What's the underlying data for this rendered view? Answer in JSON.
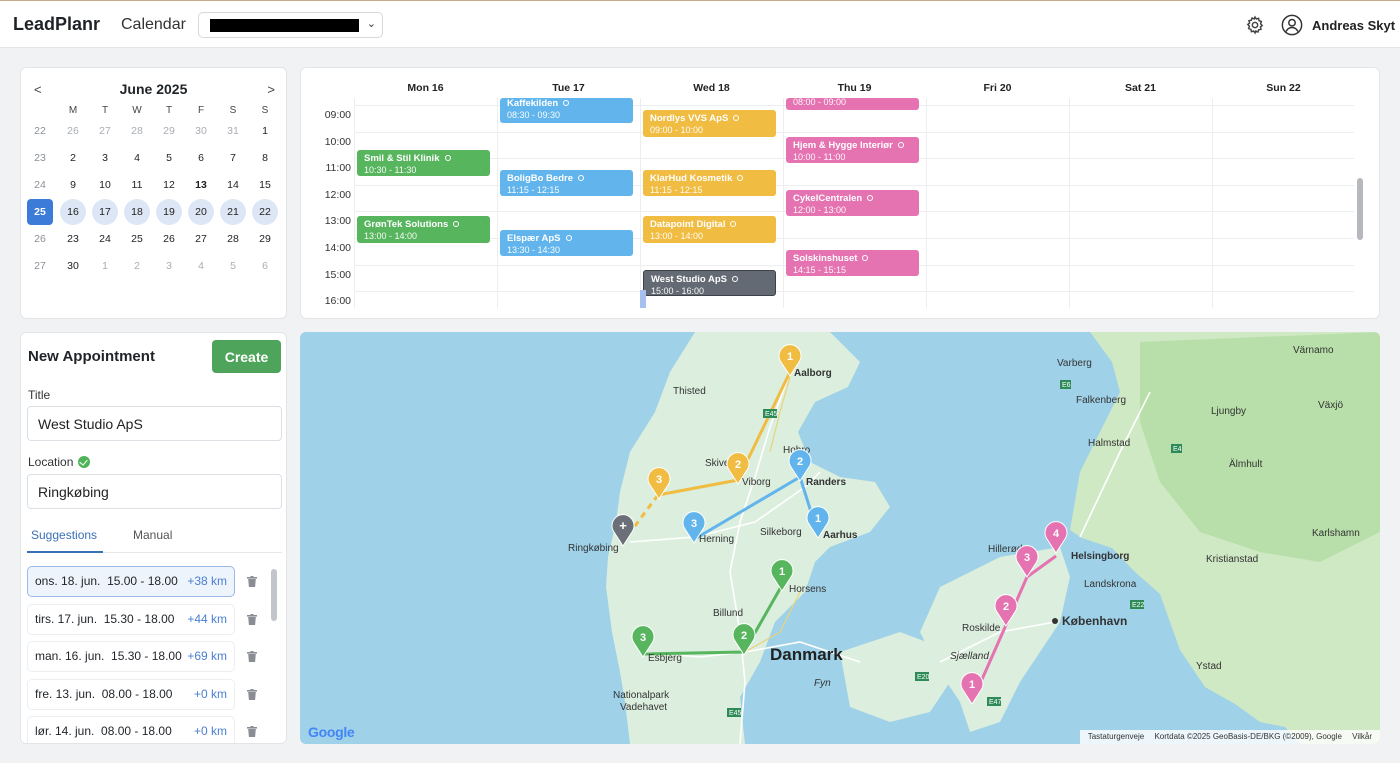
{
  "header": {
    "logo": "LeadPlanr",
    "nav_calendar": "Calendar",
    "select_chevron": "⌄",
    "user_name": "Andreas Skyt"
  },
  "mini_calendar": {
    "prev": "<",
    "next": ">",
    "month": "June 2025",
    "weekdays": [
      "M",
      "T",
      "W",
      "T",
      "F",
      "S",
      "S"
    ],
    "rows": [
      {
        "week": "22",
        "days": [
          "26",
          "27",
          "28",
          "29",
          "30",
          "31",
          "1"
        ]
      },
      {
        "week": "23",
        "days": [
          "2",
          "3",
          "4",
          "5",
          "6",
          "7",
          "8"
        ]
      },
      {
        "week": "24",
        "days": [
          "9",
          "10",
          "11",
          "12",
          "13",
          "14",
          "15"
        ]
      },
      {
        "week": "25",
        "days": [
          "16",
          "17",
          "18",
          "19",
          "20",
          "21",
          "22"
        ]
      },
      {
        "week": "26",
        "days": [
          "23",
          "24",
          "25",
          "26",
          "27",
          "28",
          "29"
        ]
      },
      {
        "week": "27",
        "days": [
          "30",
          "1",
          "2",
          "3",
          "4",
          "5",
          "6"
        ]
      }
    ]
  },
  "week_calendar": {
    "days": [
      "Mon 16",
      "Tue 17",
      "Wed 18",
      "Thu 19",
      "Fri 20",
      "Sat 21",
      "Sun 22"
    ],
    "times": [
      "09:00",
      "10:00",
      "11:00",
      "12:00",
      "13:00",
      "14:00",
      "15:00",
      "16:00"
    ],
    "events": [
      {
        "title": "Smil & Stil Klinik",
        "time": "10:30 - 11:30",
        "color": "green"
      },
      {
        "title": "GrønTek Solutions",
        "time": "13:00 - 14:00",
        "color": "green"
      },
      {
        "title": "Kaffekilden",
        "time": "08:30 - 09:30",
        "color": "blue"
      },
      {
        "title": "BoligBo Bedre",
        "time": "11:15 - 12:15",
        "color": "blue"
      },
      {
        "title": "Elspær ApS",
        "time": "13:30 - 14:30",
        "color": "blue"
      },
      {
        "title": "Nordlys VVS ApS",
        "time": "09:00 - 10:00",
        "color": "yellow"
      },
      {
        "title": "KlarHud Kosmetik",
        "time": "11:15 - 12:15",
        "color": "yellow"
      },
      {
        "title": "Datapoint Digital",
        "time": "13:00 - 14:00",
        "color": "yellow"
      },
      {
        "title": "West Studio ApS",
        "time": "15:00 - 16:00",
        "color": "gray"
      },
      {
        "title": "",
        "time": "08:00 - 09:00",
        "color": "pink"
      },
      {
        "title": "Hjem & Hygge Interiør",
        "time": "10:00 - 11:00",
        "color": "pink"
      },
      {
        "title": "CykelCentralen",
        "time": "12:00 - 13:00",
        "color": "pink"
      },
      {
        "title": "Solskinshuset",
        "time": "14:15 - 15:15",
        "color": "pink"
      }
    ]
  },
  "new_appointment": {
    "heading": "New Appointment",
    "create_label": "Create",
    "title_label": "Title",
    "title_value": "West Studio ApS",
    "location_label": "Location",
    "location_value": "Ringkøbing",
    "tab_suggestions": "Suggestions",
    "tab_manual": "Manual",
    "suggestions": [
      {
        "date": "ons. 18. jun.",
        "time": "15.00 - 18.00",
        "km": "+38 km"
      },
      {
        "date": "tirs. 17. jun.",
        "time": "15.30 - 18.00",
        "km": "+44 km"
      },
      {
        "date": "man. 16. jun.",
        "time": "15.30 - 18.00",
        "km": "+69 km"
      },
      {
        "date": "fre. 13. jun.",
        "time": "08.00 - 18.00",
        "km": "+0 km"
      },
      {
        "date": "lør. 14. jun.",
        "time": "08.00 - 18.00",
        "km": "+0 km"
      }
    ]
  },
  "map": {
    "places": {
      "aalborg": "Aalborg",
      "thisted": "Thisted",
      "hobro": "Hobro",
      "skive": "Skive",
      "viborg": "Viborg",
      "randers": "Randers",
      "silkeborg": "Silkeborg",
      "herning": "Herning",
      "aarhus": "Aarhus",
      "ringkobing": "Ringkøbing",
      "horsens": "Horsens",
      "billund": "Billund",
      "esbjerg": "Esbjerg",
      "danmark": "Danmark",
      "fyn": "Fyn",
      "nationalpark": "Nationalpark",
      "vadehavet": "Vadehavet",
      "varberg": "Varberg",
      "falkenberg": "Falkenberg",
      "halmstad": "Halmstad",
      "varnamo": "Värnamo",
      "ljungby": "Ljungby",
      "vaxjo": "Växjö",
      "almhult": "Älmhult",
      "karlshamn": "Karlshamn",
      "kristianstad": "Kristianstad",
      "helsingborg": "Helsingborg",
      "hillerod": "Hillerød",
      "landskrona": "Landskrona",
      "roskilde": "Roskilde",
      "kobenhavn": "København",
      "sjaelland": "Sjælland",
      "ystad": "Ystad"
    },
    "roads": {
      "e45": "E45",
      "e6": "E6",
      "e4": "E4",
      "e22": "E22",
      "e20": "E20",
      "e47": "E47"
    },
    "markers": {
      "y1": "1",
      "y2": "2",
      "y3": "3",
      "b1": "1",
      "b2": "2",
      "b3": "3",
      "g1": "1",
      "g2": "2",
      "g3": "3",
      "p1": "1",
      "p2": "2",
      "p3": "3",
      "p4": "4",
      "new": "+"
    },
    "google": "Google",
    "attribution": [
      "Tastaturgenveje",
      "Kortdata ©2025 GeoBasis-DE/BKG (©2009), Google",
      "Vilkår"
    ]
  },
  "colors": {
    "green": "#57b55e",
    "blue": "#62b5ec",
    "yellow": "#f0bc42",
    "pink": "#e572b1",
    "gray": "#646a73",
    "accent": "#3d7bd9",
    "create": "#4ea45a"
  }
}
